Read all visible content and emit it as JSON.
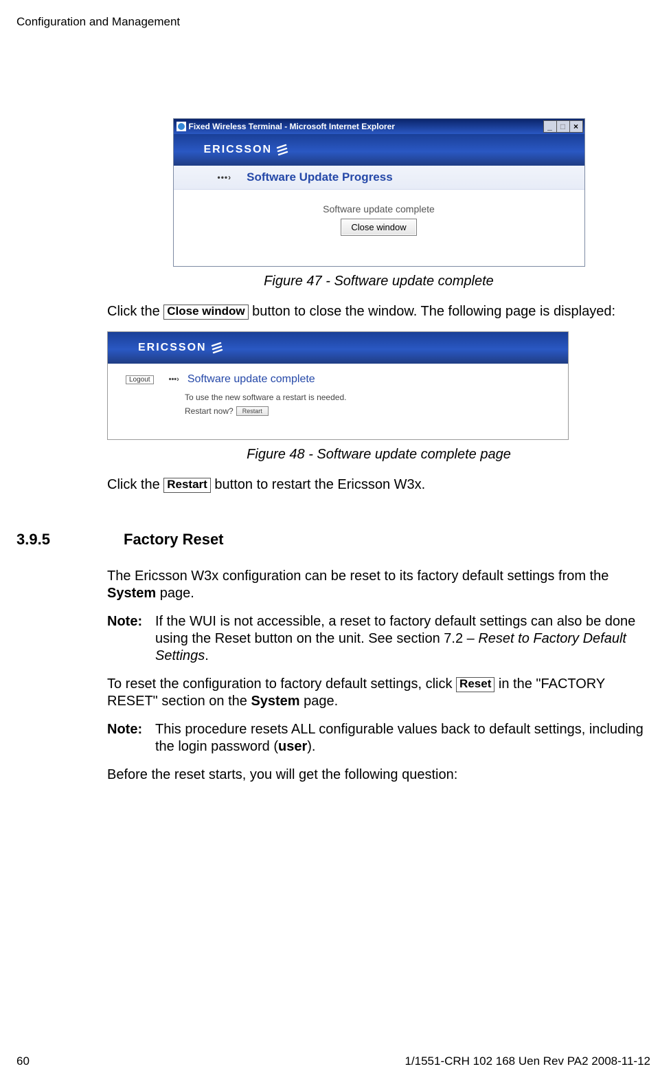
{
  "header": {
    "section": "Configuration and Management"
  },
  "fig47": {
    "window_title": "Fixed Wireless Terminal - Microsoft Internet Explorer",
    "brand": "ERICSSON",
    "subbar_title": "Software Update Progress",
    "status_text": "Software update complete",
    "close_btn": "Close window",
    "caption": "Figure 47 - Software update complete"
  },
  "para1_pre": "Click the ",
  "para1_btn": "Close window",
  "para1_post": " button to close the window. The following page is displayed:",
  "fig48": {
    "brand": "ERICSSON",
    "logout": "Logout",
    "title": "Software update complete",
    "line1": "To use the new software a restart is needed.",
    "restart_q": "Restart now?",
    "restart_btn": "Restart",
    "caption": "Figure 48 - Software update complete page"
  },
  "para2_pre": "Click the ",
  "para2_btn": "Restart",
  "para2_post": " button to restart the Ericsson W3x.",
  "section": {
    "num": "3.9.5",
    "title": "Factory Reset"
  },
  "para3_a": "The Ericsson W3x configuration can be reset to its factory default settings from the ",
  "para3_b": "System",
  "para3_c": " page.",
  "note1": {
    "label": "Note:",
    "a": "If the WUI is not accessible, a reset to factory default settings can also be done using the Reset button on the unit. See section 7.2 – ",
    "b": "Reset to Factory Default Settings",
    "c": "."
  },
  "para4_a": "To reset the configuration to factory default settings, click ",
  "para4_btn": "Reset",
  "para4_b": " in the \"FACTORY RESET\" section on the ",
  "para4_c": "System",
  "para4_d": " page.",
  "note2": {
    "label": "Note:",
    "a": "This procedure resets ALL configurable values back to default settings, including the login password (",
    "b": "user",
    "c": ")."
  },
  "para5": "Before the reset starts, you will get the following question:",
  "footer": {
    "page": "60",
    "ref": "1/1551-CRH 102 168 Uen Rev PA2  2008-11-12"
  }
}
